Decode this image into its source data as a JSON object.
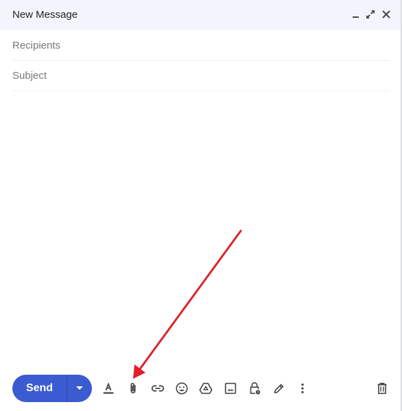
{
  "window": {
    "title": "New Message",
    "controls": {
      "minimize": "minimize-icon",
      "fullscreen": "expand-icon",
      "close": "close-icon"
    }
  },
  "fields": {
    "recipients": {
      "value": "",
      "placeholder": "Recipients"
    },
    "subject": {
      "value": "",
      "placeholder": "Subject"
    },
    "body": {
      "value": ""
    }
  },
  "footer": {
    "send_label": "Send",
    "send_options_icon": "caret-down-icon",
    "tools": [
      {
        "name": "formatting-options",
        "icon": "text-format-icon"
      },
      {
        "name": "attach-files",
        "icon": "paperclip-icon"
      },
      {
        "name": "insert-link",
        "icon": "link-icon"
      },
      {
        "name": "insert-emoji",
        "icon": "emoji-icon"
      },
      {
        "name": "insert-drive-file",
        "icon": "drive-icon"
      },
      {
        "name": "insert-photo",
        "icon": "image-icon"
      },
      {
        "name": "confidential-mode",
        "icon": "lock-clock-icon"
      },
      {
        "name": "insert-signature",
        "icon": "pen-icon"
      },
      {
        "name": "more-options",
        "icon": "more-vert-icon"
      }
    ],
    "discard_icon": "trash-icon"
  },
  "annotation": {
    "type": "arrow",
    "color": "#d9232d",
    "points_to": "attach-files"
  },
  "colors": {
    "header_bg": "#f2f6fc",
    "send_bg": "#3b5bd0",
    "icon": "#444746"
  }
}
